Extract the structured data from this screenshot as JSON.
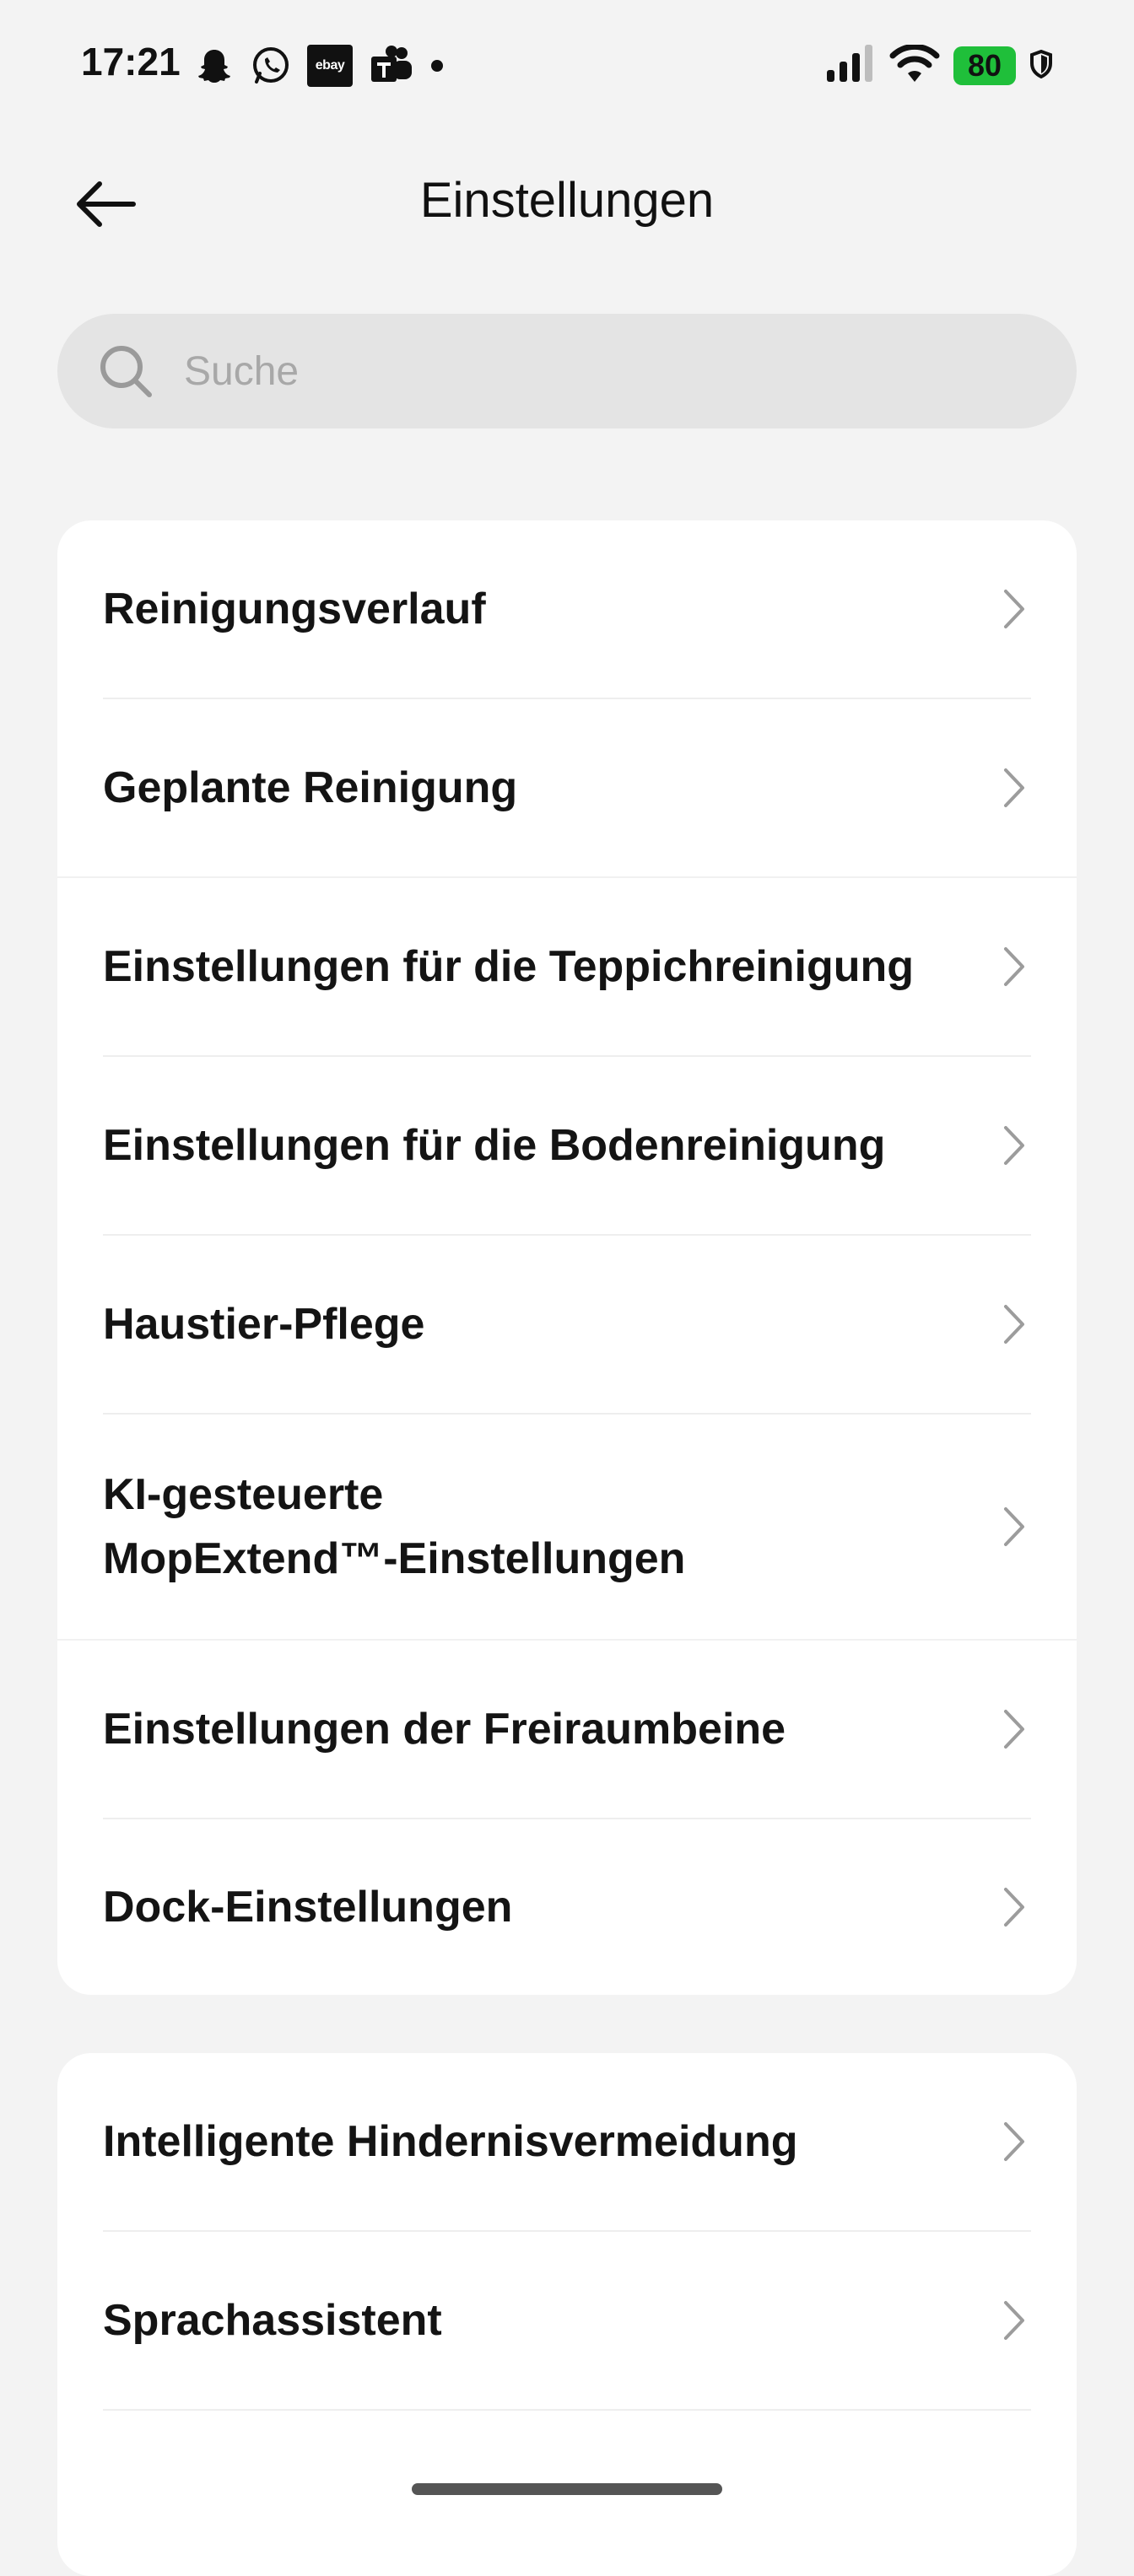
{
  "status_bar": {
    "time": "17:21",
    "battery": "80",
    "notification_icons": [
      "snapchat-icon",
      "whatsapp-icon",
      "ebay-icon",
      "teams-icon",
      "dot-icon"
    ],
    "ebay_label": "ebay",
    "system_icons": [
      "signal-icon",
      "wifi-icon",
      "battery-icon",
      "shield-icon"
    ],
    "battery_color": "#1fbf3a"
  },
  "header": {
    "title": "Einstellungen",
    "back_icon": "arrow-left-icon"
  },
  "search": {
    "placeholder": "Suche",
    "value": ""
  },
  "groups": [
    {
      "items": [
        {
          "label": "Reinigungsverlauf"
        },
        {
          "label": "Geplante Reinigung"
        },
        {
          "label": "Einstellungen für die Teppichreinigung"
        },
        {
          "label": "Einstellungen für die Bodenreinigung"
        },
        {
          "label": "Haustier-Pflege"
        },
        {
          "label_line1": "KI-gesteuerte",
          "label_line2": "MopExtend™-Einstellungen"
        },
        {
          "label": "Einstellungen der Freiraumbeine"
        },
        {
          "label": "Dock-Einstellungen"
        }
      ]
    },
    {
      "items": [
        {
          "label": "Intelligente Hindernisvermeidung"
        },
        {
          "label": "Sprachassistent"
        }
      ]
    }
  ]
}
